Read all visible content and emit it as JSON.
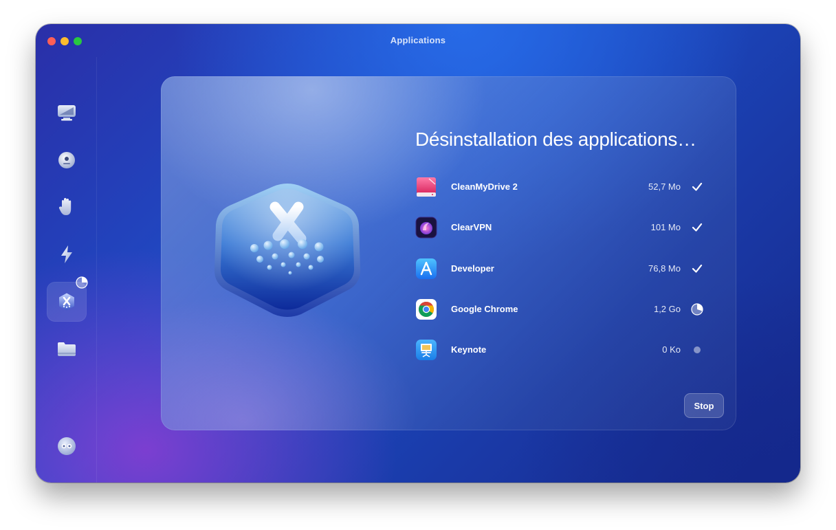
{
  "window": {
    "title": "Applications"
  },
  "sidebar": {
    "items": [
      {
        "name": "cleanup",
        "icon": "monitor-icon"
      },
      {
        "name": "protection",
        "icon": "shield-dot-icon"
      },
      {
        "name": "privacy",
        "icon": "hand-icon"
      },
      {
        "name": "speed",
        "icon": "lightning-icon"
      },
      {
        "name": "applications",
        "icon": "app-hexagon-icon",
        "active": true,
        "progress": 0.25
      },
      {
        "name": "files",
        "icon": "folder-icon"
      }
    ],
    "footer_icon": "assistant-icon"
  },
  "main": {
    "heading": "Désinstallation des applications…",
    "hero_icon": "uninstaller-hexagon-icon",
    "apps": [
      {
        "name": "CleanMyDrive 2",
        "size": "52,7 Mo",
        "status": "done",
        "icon": "cleanmydrive-icon"
      },
      {
        "name": "ClearVPN",
        "size": "101 Mo",
        "status": "done",
        "icon": "clearvpn-icon"
      },
      {
        "name": "Developer",
        "size": "76,8 Mo",
        "status": "done",
        "icon": "developer-icon"
      },
      {
        "name": "Google Chrome",
        "size": "1,2 Go",
        "status": "in-progress",
        "progress": 0.3,
        "icon": "chrome-icon"
      },
      {
        "name": "Keynote",
        "size": "0 Ko",
        "status": "pending",
        "icon": "keynote-icon"
      }
    ],
    "stop_label": "Stop"
  },
  "colors": {
    "accent": "#ffffff",
    "window_bg": "#1d4fc9",
    "close": "#ff5f57",
    "minimize": "#febc2e",
    "maximize": "#28c840"
  }
}
